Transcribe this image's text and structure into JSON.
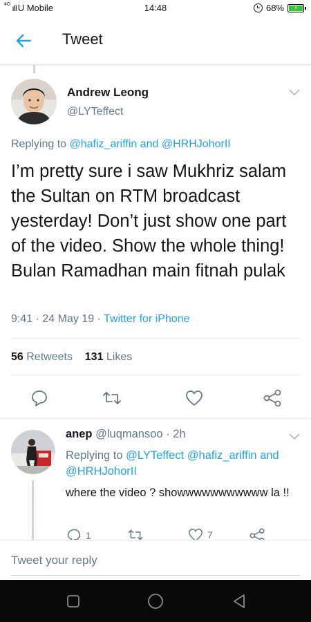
{
  "status_bar": {
    "network": "4G",
    "carrier": "U Mobile",
    "time": "14:48",
    "battery": "68%"
  },
  "header": {
    "title": "Tweet",
    "back_icon": "arrow-left-icon"
  },
  "tweet": {
    "author_name": "Andrew Leong",
    "author_handle": "@LYTeffect",
    "replying_prefix": "Replying to",
    "replying_user1": "@hafiz_ariffin",
    "replying_and": "and",
    "replying_user2": "@HRHJohorII",
    "text": "I’m pretty sure i saw Mukhriz salam the Sultan on RTM broadcast yesterday! Don’t just show one part of the video. Show the whole thing! Bulan Ramadhan main fitnah pulak",
    "time": "9:41",
    "date": "24 May 19",
    "source": "Twitter for iPhone",
    "retweets_count": "56",
    "retweets_label": "Retweets",
    "likes_count": "131",
    "likes_label": "Likes"
  },
  "reply": {
    "author_name": "anep",
    "author_handle": "@luqmansoo",
    "age": "2h",
    "replying_prefix": "Replying to",
    "replying_user1": "@LYTeffect",
    "replying_user2": "@hafiz_ariffin",
    "replying_and": "and",
    "replying_user3": "@HRHJohorII",
    "text": "where the video ? showwwwwwwwwww la !!",
    "reply_count": "1",
    "like_count": "7"
  },
  "compose": {
    "placeholder": "Tweet your reply"
  },
  "colors": {
    "accent": "#1da1f2",
    "secondary_text": "#657786",
    "primary_text": "#14171a",
    "divider": "#e1e8ed",
    "nav_bar": "#0a0a0a"
  }
}
